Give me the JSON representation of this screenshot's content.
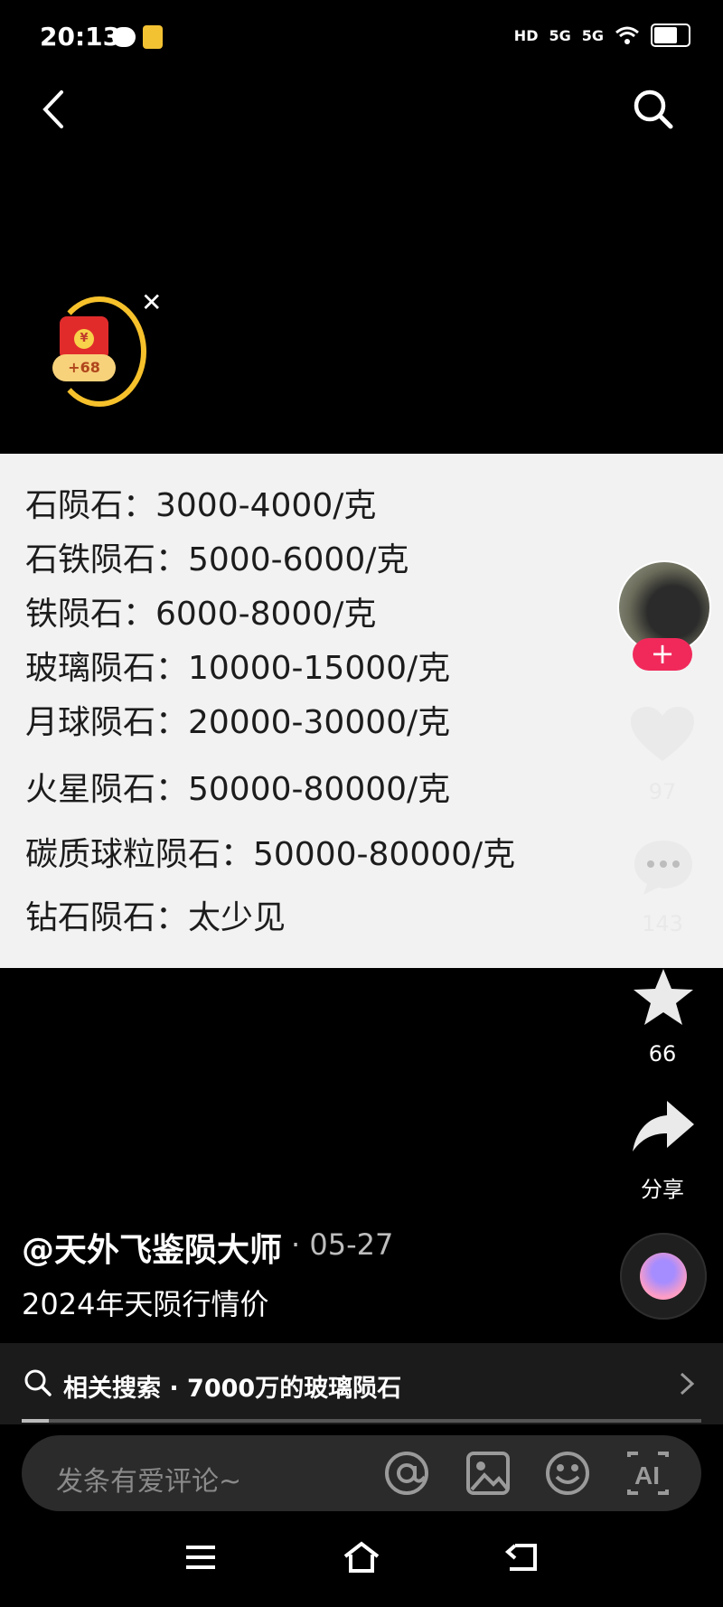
{
  "status_bar": {
    "time": "20:13",
    "network_1": "HD",
    "network_2": "5G",
    "network_3": "5G",
    "battery_level": 0.7
  },
  "red_packet": {
    "badge_text": "+68",
    "coin_symbol": "¥"
  },
  "rows": [
    "石陨石：3000-4000/克",
    "石铁陨石：5000-6000/克",
    "铁陨石：6000-8000/克",
    "玻璃陨石：10000-15000/克",
    "月球陨石：20000-30000/克",
    "火星陨石：50000-80000/克",
    "碳质球粒陨石：50000-80000/克",
    "钻石陨石：太少见"
  ],
  "rail": {
    "like_count": "97",
    "comment_count": "143",
    "favorite_count": "66",
    "share_label": "分享"
  },
  "post": {
    "author": "@天外飞鉴陨大师",
    "date": "· 05-27",
    "caption": "2024年天陨行情价"
  },
  "related_search": "相关搜索 · 7000万的玻璃陨石",
  "comment": {
    "placeholder": "发条有爱评论~"
  },
  "colors": {
    "follow": "#f1295b",
    "accent_ring": "#f6c12b"
  },
  "video_progress": 0.04
}
